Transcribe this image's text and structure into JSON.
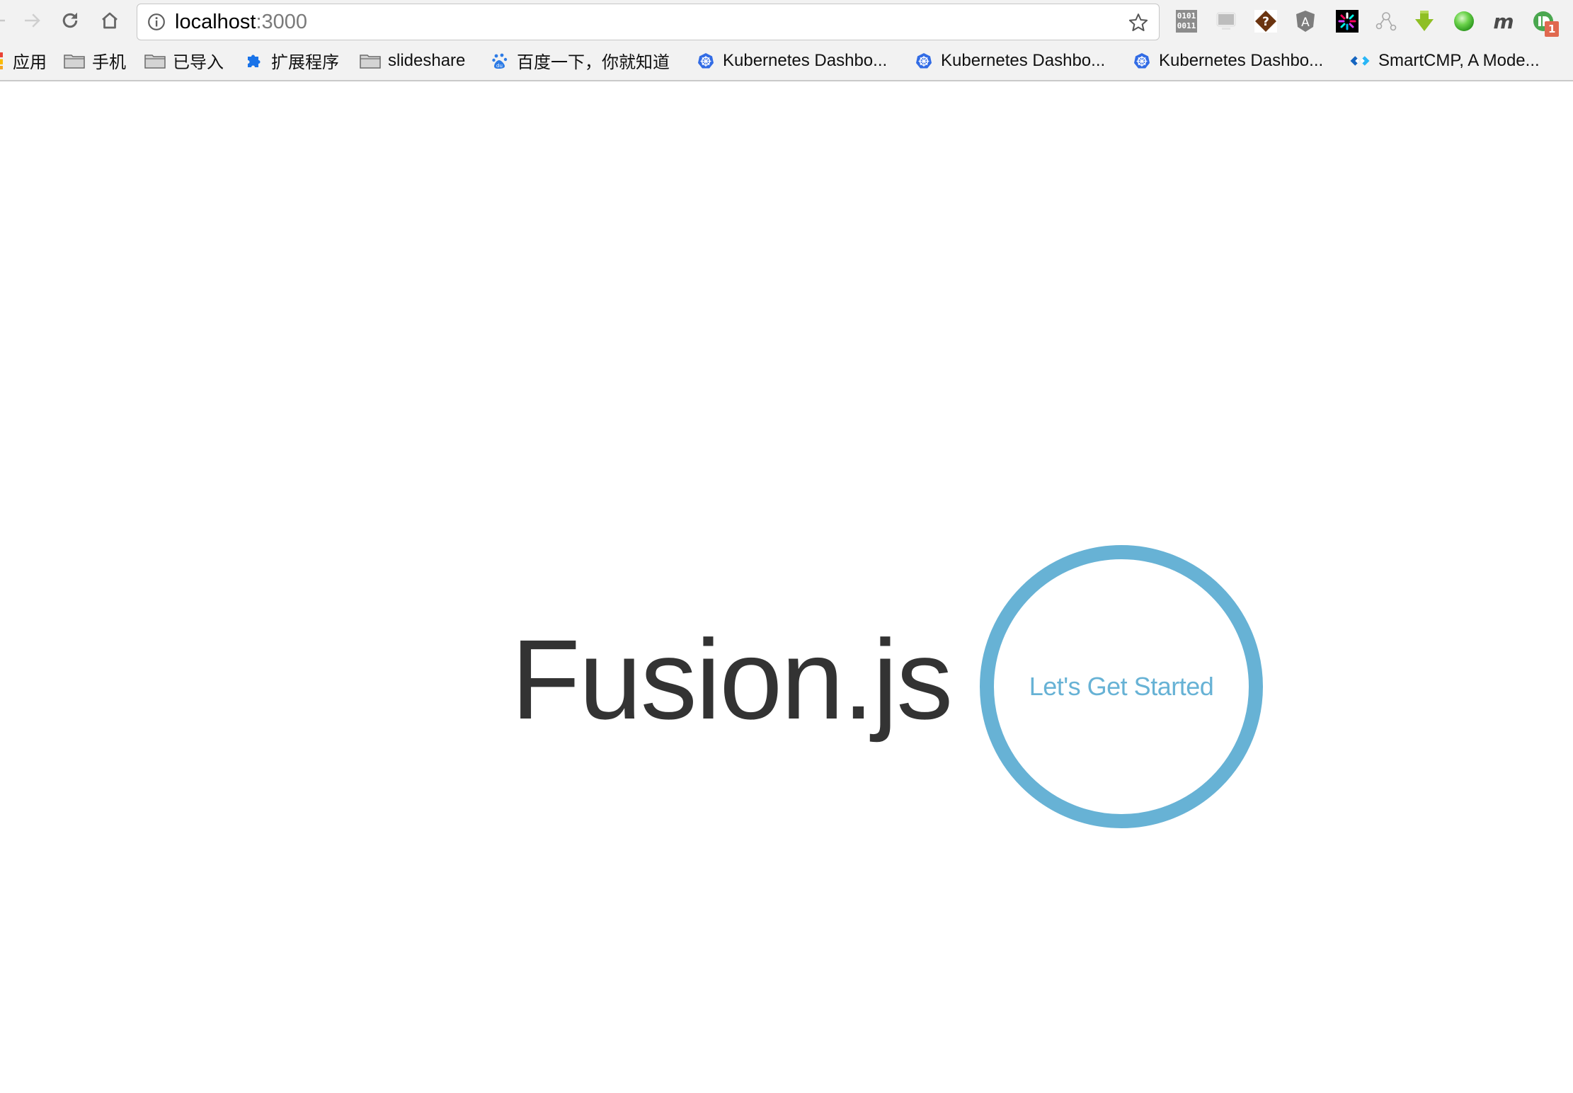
{
  "browser": {
    "url_host": "localhost",
    "url_port": ":3000",
    "nav": {
      "back": "back-arrow-icon",
      "forward": "forward-arrow-icon",
      "reload": "reload-icon",
      "home": "home-icon"
    },
    "extensions": [
      {
        "name": "binary-icon",
        "badge": ""
      },
      {
        "name": "monitor-icon",
        "badge": ""
      },
      {
        "name": "question-diamond-icon",
        "badge": ""
      },
      {
        "name": "angular-icon",
        "badge": ""
      },
      {
        "name": "jwt-icon",
        "badge": ""
      },
      {
        "name": "graph-nodes-icon",
        "badge": ""
      },
      {
        "name": "download-arrow-icon",
        "badge": ""
      },
      {
        "name": "green-ball-icon",
        "badge": ""
      },
      {
        "name": "m-icon",
        "badge": ""
      },
      {
        "name": "pushbullet-icon",
        "badge": "1"
      }
    ],
    "bookmarks": [
      {
        "label": "应用",
        "icon": "apps-grid-icon"
      },
      {
        "label": "手机",
        "icon": "folder-icon"
      },
      {
        "label": "已导入",
        "icon": "folder-icon"
      },
      {
        "label": "扩展程序",
        "icon": "puzzle-icon"
      },
      {
        "label": "slideshare",
        "icon": "folder-icon"
      },
      {
        "label": "百度一下，你就知道",
        "icon": "baidu-icon"
      },
      {
        "label": "Kubernetes Dashbo...",
        "icon": "kubernetes-icon"
      },
      {
        "label": "Kubernetes Dashbo...",
        "icon": "kubernetes-icon"
      },
      {
        "label": "Kubernetes Dashbo...",
        "icon": "kubernetes-icon"
      },
      {
        "label": "SmartCMP, A Mode...",
        "icon": "smartcmp-icon"
      }
    ]
  },
  "page": {
    "title": "Fusion.js",
    "cta_label": "Let's Get Started",
    "accent_color": "#67b2d5",
    "title_color": "#333333"
  }
}
